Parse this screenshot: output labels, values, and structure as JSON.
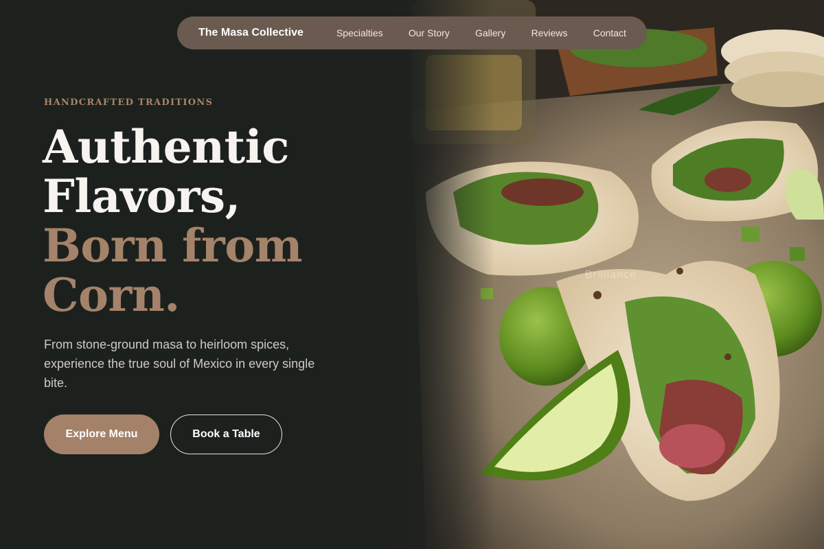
{
  "nav": {
    "brand": "The Masa Collective",
    "links": [
      {
        "label": "Specialties"
      },
      {
        "label": "Our Story"
      },
      {
        "label": "Gallery"
      },
      {
        "label": "Reviews"
      },
      {
        "label": "Contact"
      }
    ]
  },
  "hero": {
    "eyebrow": "HANDCRAFTED TRADITIONS",
    "headline_line1": "Authentic",
    "headline_line2": "Flavors,",
    "headline_line3": "Born from",
    "headline_line4": "Corn.",
    "subtitle": "From stone-ground masa to heirloom spices, experience the true soul of Mexico in every single bite.",
    "primary_button": "Explore Menu",
    "secondary_button": "Book a Table"
  },
  "photo": {
    "watermark": "Brilliance"
  },
  "colors": {
    "background": "#1d211e",
    "accent_tan": "#a4836a",
    "nav_pill": "#6b5a50"
  }
}
